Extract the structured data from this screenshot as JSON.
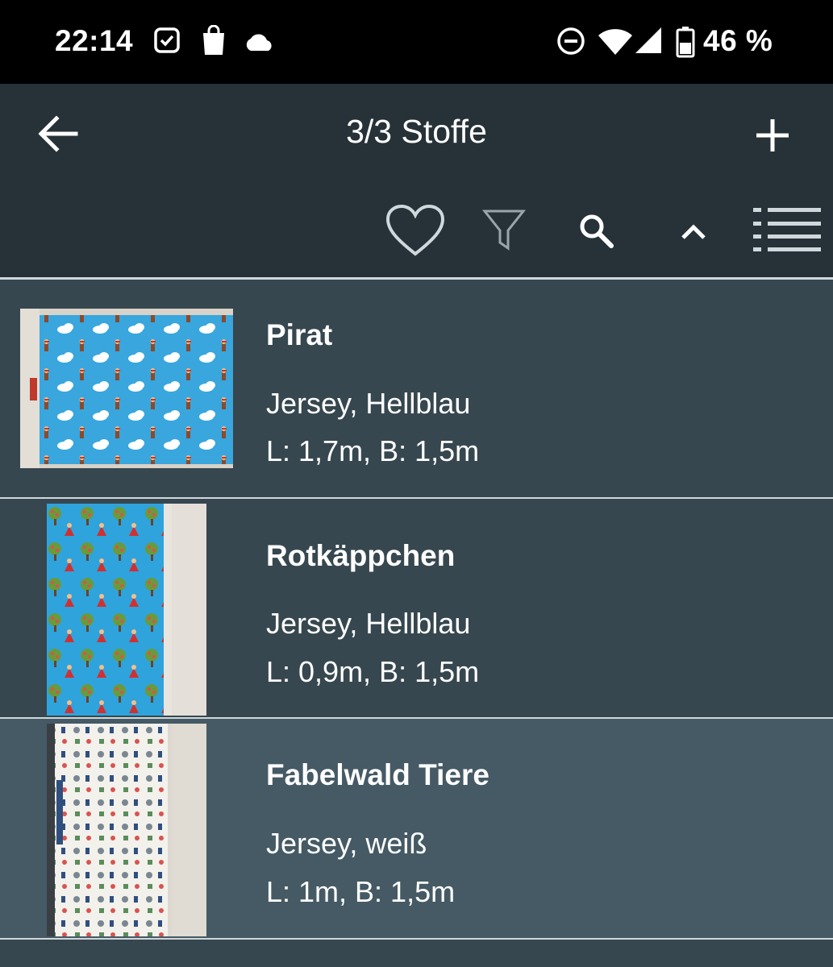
{
  "status_bar": {
    "time": "22:14",
    "battery_text": "46 %",
    "icons": [
      "checkbox-notification-icon",
      "shopping-bag-icon",
      "cloud-icon",
      "do-not-disturb-icon",
      "wifi-icon",
      "signal-icon",
      "battery-icon"
    ]
  },
  "app_bar": {
    "title": "3/3 Stoffe",
    "back_icon": "arrow-back-icon",
    "add_icon": "plus-icon",
    "tools": [
      "heart-icon",
      "filter-icon",
      "search-icon",
      "chevron-up-icon",
      "list-view-icon"
    ]
  },
  "items": [
    {
      "title": "Pirat",
      "subtitle": "Jersey, Hellblau",
      "dimensions": "L: 1,7m, B: 1,5m"
    },
    {
      "title": "Rotkäppchen",
      "subtitle": "Jersey, Hellblau",
      "dimensions": "L: 0,9m, B: 1,5m"
    },
    {
      "title": "Fabelwald Tiere",
      "subtitle": "Jersey, weiß",
      "dimensions": "L: 1m, B: 1,5m"
    }
  ],
  "colors": {
    "status_bar_bg": "#000000",
    "app_bar_bg": "#263238",
    "list_bg": "#37474f",
    "divider": "#cfd8dc"
  }
}
